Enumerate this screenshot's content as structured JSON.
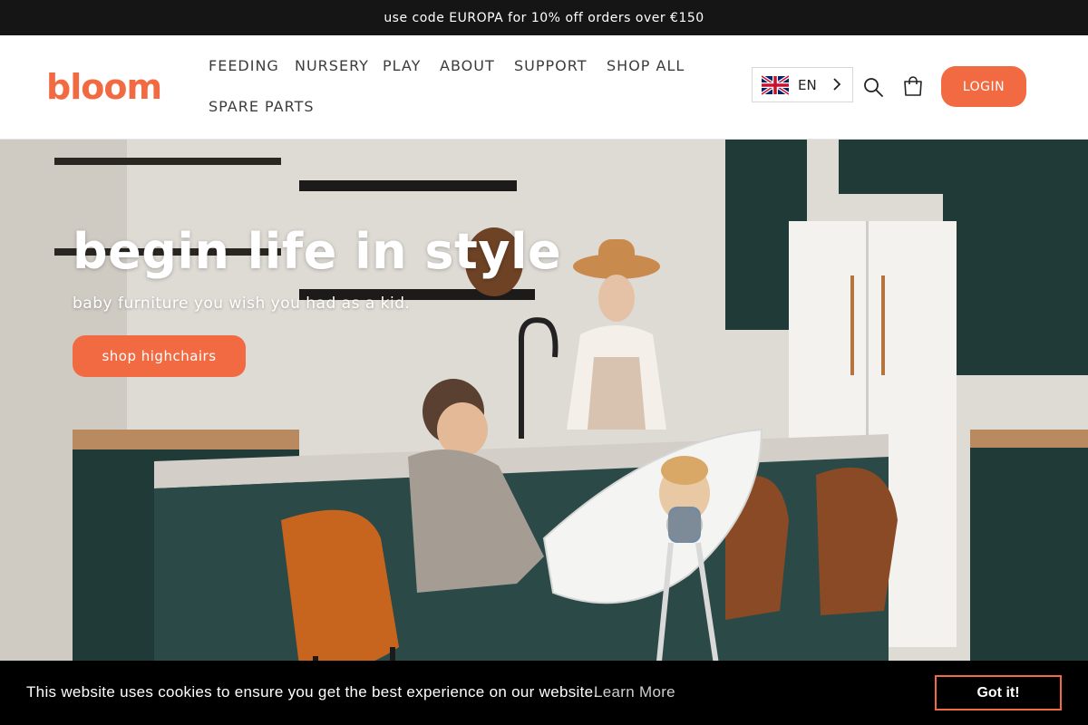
{
  "announcement": {
    "text": "use code EUROPA for 10% off orders over €150"
  },
  "header": {
    "logo": "bloom",
    "nav": [
      "FEEDING",
      "NURSERY",
      "PLAY",
      "ABOUT",
      "SUPPORT",
      "SHOP ALL",
      "SPARE PARTS"
    ],
    "language": {
      "code": "EN",
      "flag_icon": "uk-flag-icon"
    },
    "icons": [
      "search-icon",
      "cart-icon"
    ],
    "login_label": "LOGIN"
  },
  "hero": {
    "title": "begin life in style",
    "subtitle": "baby furniture you wish you had as a kid.",
    "cta_label": "shop highchairs"
  },
  "cookie": {
    "message": "This website uses cookies to ensure you get the best experience on our website.",
    "learn_more": "Learn More",
    "accept_label": "Got it!"
  },
  "colors": {
    "brand": "#f26a41",
    "announcement_bg": "#151515",
    "cookie_bg": "#000000",
    "cabinet": "#1f3a37"
  }
}
